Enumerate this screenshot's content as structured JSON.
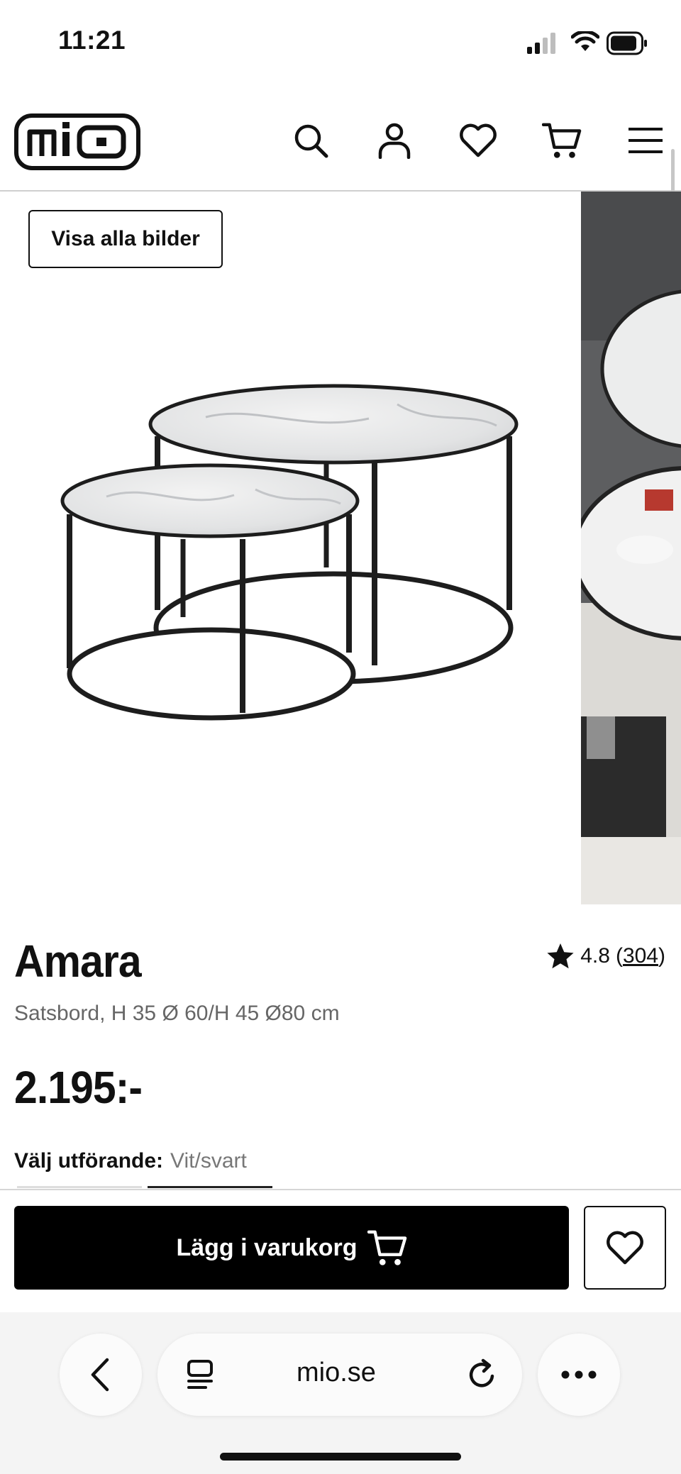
{
  "status_bar": {
    "time": "11:21"
  },
  "header": {
    "logo_text": "mio",
    "icons": [
      "search-icon",
      "account-icon",
      "wishlist-heart-icon",
      "cart-icon",
      "menu-icon"
    ]
  },
  "gallery": {
    "show_all_label": "Visa alla bilder"
  },
  "product": {
    "name": "Amara",
    "rating_value": "4.8",
    "rating_count_open": "(",
    "rating_count": "304",
    "rating_count_close": ")",
    "description": "Satsbord, H 35 Ø 60/H 45 Ø80 cm",
    "price": "2.195:-",
    "variant_label": "Välj utförande:",
    "variant_value": "Vit/svart"
  },
  "actions": {
    "add_to_cart_label": "Lägg i varukorg"
  },
  "browser": {
    "url": "mio.se"
  },
  "colors": {
    "accent": "#000000",
    "text_muted": "#666666"
  }
}
